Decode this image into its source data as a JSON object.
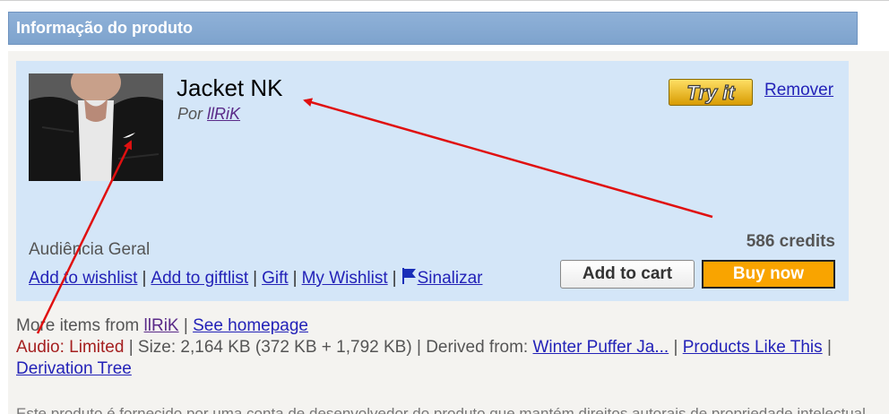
{
  "section": {
    "title": "Informação do produto"
  },
  "product": {
    "title": "Jacket NK",
    "by_prefix": "Por",
    "creator": "llRiK",
    "try_it_label": "Try it",
    "remove_label": "Remover",
    "audience": "Audiência Geral",
    "price": "586 credits",
    "actions": {
      "wishlist": "Add to wishlist",
      "giftlist": "Add to giftlist",
      "gift": "Gift",
      "my_wishlist": "My Wishlist",
      "flag": "Sinalizar"
    },
    "add_to_cart": "Add to cart",
    "buy_now": "Buy now"
  },
  "meta": {
    "more_items_prefix": "More items from",
    "creator": "llRiK",
    "see_homepage": "See homepage",
    "audio": "Audio: Limited",
    "size": "Size: 2,164 KB (372 KB + 1,792 KB)",
    "derived_prefix": "Derived from:",
    "derived_from": "Winter Puffer Ja...",
    "products_like": "Products Like This",
    "derivation_tree": "Derivation Tree"
  },
  "truncated_text": "Este produto é fornecido por uma conta de desenvolvedor do produto que mantém direitos autorais de propriedade intelectual",
  "colors": {
    "card_bg": "#d4e6f8",
    "buy_button": "#f9a400",
    "annotation_arrow": "#e01010",
    "link": "#2322b8"
  }
}
